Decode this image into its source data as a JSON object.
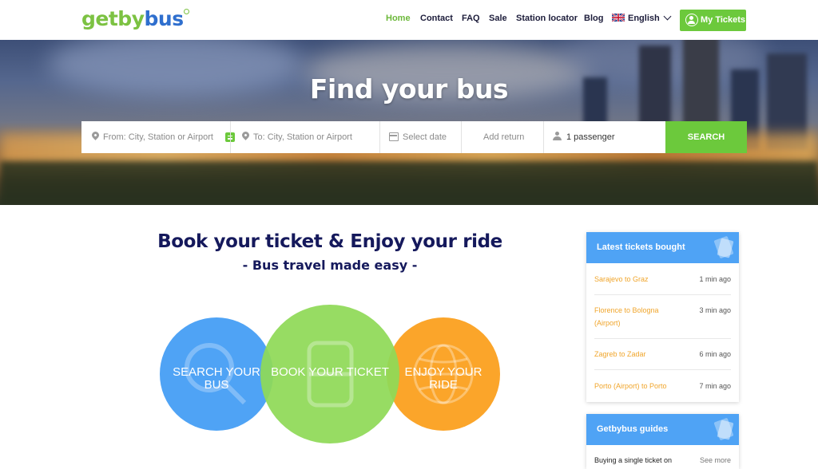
{
  "header": {
    "logo": {
      "part1": "getby",
      "part2": "bus"
    },
    "nav": [
      {
        "label": "Home",
        "active": true
      },
      {
        "label": "Contact"
      },
      {
        "label": "FAQ"
      },
      {
        "label": "Sale"
      },
      {
        "label": "Station locator"
      },
      {
        "label": "Blog"
      }
    ],
    "language": {
      "label": "English",
      "flag_icon": "uk-flag-icon"
    },
    "my_tickets_label": "My Tickets"
  },
  "hero": {
    "title": "Find your bus",
    "search": {
      "from_placeholder": "From: City, Station or Airport",
      "to_placeholder": "To: City, Station or Airport",
      "date_placeholder": "Select date",
      "return_placeholder": "Add return",
      "passengers": "1 passenger",
      "button_label": "SEARCH"
    }
  },
  "main": {
    "headline": "Book your ticket & Enjoy your ride",
    "subline": "- Bus travel made easy -",
    "steps": [
      {
        "line1": "SEARCH YOUR",
        "line2": "BUS",
        "icon": "magnifier-icon",
        "color": "#4fa3f5"
      },
      {
        "line1": "BOOK YOUR TICKET",
        "line2": "",
        "icon": "ticket-icon",
        "color": "#8fd957"
      },
      {
        "line1": "ENJOY YOUR",
        "line2": "RIDE",
        "icon": "globe-icon",
        "color": "#fba52a"
      }
    ]
  },
  "sidebar": {
    "latest": {
      "title": "Latest tickets bought",
      "items": [
        {
          "route": "Sarajevo to Graz",
          "ago": "1 min ago"
        },
        {
          "route": "Florence to Bologna (Airport)",
          "ago": "3 min ago"
        },
        {
          "route": "Zagreb to Zadar",
          "ago": "6 min ago"
        },
        {
          "route": "Porto (Airport) to Porto",
          "ago": "7 min ago"
        }
      ]
    },
    "guides": {
      "title": "Getbybus guides",
      "items": [
        {
          "title": "Buying a single ticket on",
          "link": "See more"
        }
      ]
    }
  },
  "colors": {
    "brand_green": "#6cc93c",
    "brand_blue": "#4fa3f5",
    "orange": "#fba52a",
    "navy": "#15195c"
  }
}
